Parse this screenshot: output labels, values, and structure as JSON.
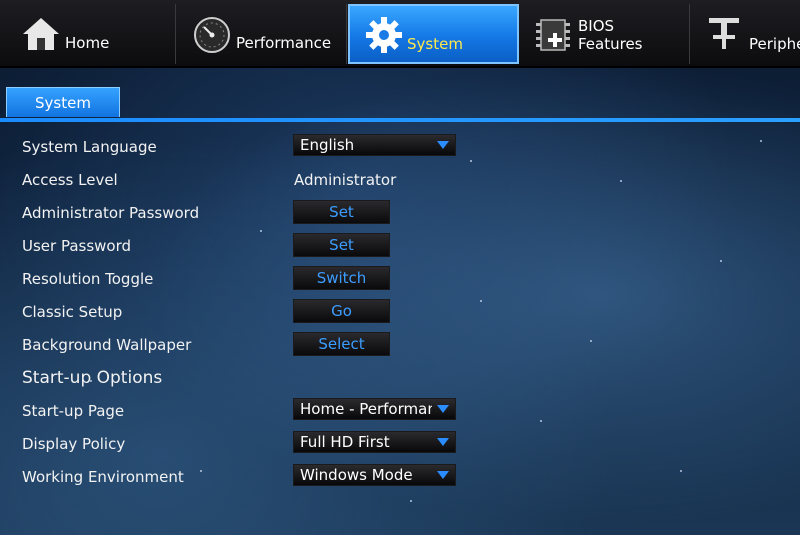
{
  "nav": {
    "tabs": [
      {
        "label": "Home",
        "icon": "house-icon"
      },
      {
        "label": "Performance",
        "icon": "gauge-icon"
      },
      {
        "label": "System",
        "icon": "gear-icon",
        "active": true
      },
      {
        "label_line1": "BIOS",
        "label_line2": "Features",
        "icon": "chip-icon"
      },
      {
        "label": "Peripherals",
        "icon": "peripheral-icon"
      }
    ]
  },
  "subtab": {
    "label": "System"
  },
  "settings": {
    "language": {
      "label": "System Language",
      "value": "English"
    },
    "access": {
      "label": "Access Level",
      "value": "Administrator"
    },
    "admin_pw": {
      "label": "Administrator Password",
      "button": "Set"
    },
    "user_pw": {
      "label": "User Password",
      "button": "Set"
    },
    "resolution": {
      "label": "Resolution Toggle",
      "button": "Switch"
    },
    "classic": {
      "label": "Classic Setup",
      "button": "Go"
    },
    "wallpaper": {
      "label": "Background Wallpaper",
      "button": "Select"
    }
  },
  "startup": {
    "heading": "Start-up Options",
    "page": {
      "label": "Start-up Page",
      "value": "Home - Performance"
    },
    "display": {
      "label": "Display Policy",
      "value": "Full HD First"
    },
    "environment": {
      "label": "Working Environment",
      "value": "Windows Mode"
    }
  },
  "colors": {
    "accent": "#1b8cff",
    "button_text": "#3c9dff",
    "active_tab": "#1478e6"
  }
}
